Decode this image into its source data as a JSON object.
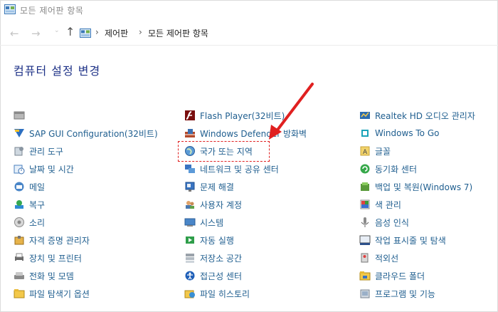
{
  "window": {
    "title": "모든 제어판 항목"
  },
  "address": {
    "nav": {
      "back": "←",
      "forward": "→",
      "recent": "⌄",
      "up": "↑"
    },
    "separator": "›",
    "crumbs": [
      "제어판",
      "모든 제어판 항목"
    ]
  },
  "page": {
    "title": "컴퓨터 설정 변경"
  },
  "columns": [
    [
      {
        "label": "",
        "icon": "generic-window-icon"
      },
      {
        "label": "SAP GUI Configuration(32비트)",
        "icon": "sap-gui-icon"
      },
      {
        "label": "관리 도구",
        "icon": "admin-tools-icon"
      },
      {
        "label": "날짜 및 시간",
        "icon": "date-time-icon"
      },
      {
        "label": "메일",
        "icon": "mail-icon"
      },
      {
        "label": "복구",
        "icon": "recovery-icon"
      },
      {
        "label": "소리",
        "icon": "sound-icon"
      },
      {
        "label": "자격 증명 관리자",
        "icon": "credential-manager-icon"
      },
      {
        "label": "장치 및 프린터",
        "icon": "devices-printers-icon"
      },
      {
        "label": "전화 및 모뎀",
        "icon": "phone-modem-icon"
      },
      {
        "label": "파일 탐색기 옵션",
        "icon": "file-explorer-options-icon"
      }
    ],
    [
      {
        "label": "Flash Player(32비트)",
        "icon": "flash-player-icon"
      },
      {
        "label": "Windows Defender 방화벽",
        "icon": "firewall-icon"
      },
      {
        "label": "국가 또는 지역",
        "icon": "region-icon"
      },
      {
        "label": "네트워크 및 공유 센터",
        "icon": "network-sharing-icon"
      },
      {
        "label": "문제 해결",
        "icon": "troubleshooting-icon"
      },
      {
        "label": "사용자 계정",
        "icon": "user-accounts-icon"
      },
      {
        "label": "시스템",
        "icon": "system-icon"
      },
      {
        "label": "자동 실행",
        "icon": "autoplay-icon"
      },
      {
        "label": "저장소 공간",
        "icon": "storage-spaces-icon"
      },
      {
        "label": "접근성 센터",
        "icon": "ease-of-access-icon"
      },
      {
        "label": "파일 히스토리",
        "icon": "file-history-icon"
      }
    ],
    [
      {
        "label": "Realtek HD 오디오 관리자",
        "icon": "realtek-audio-icon"
      },
      {
        "label": "Windows To Go",
        "icon": "windows-to-go-icon"
      },
      {
        "label": "글꼴",
        "icon": "fonts-icon"
      },
      {
        "label": "동기화 센터",
        "icon": "sync-center-icon"
      },
      {
        "label": "백업 및 복원(Windows 7)",
        "icon": "backup-restore-icon"
      },
      {
        "label": "색 관리",
        "icon": "color-management-icon"
      },
      {
        "label": "음성 인식",
        "icon": "speech-recognition-icon"
      },
      {
        "label": "작업 표시줄 및 탐색",
        "icon": "taskbar-navigation-icon"
      },
      {
        "label": "적외선",
        "icon": "infrared-icon"
      },
      {
        "label": "클라우드 폴더",
        "icon": "work-folders-icon"
      },
      {
        "label": "프로그램 및 기능",
        "icon": "programs-features-icon"
      }
    ]
  ],
  "annotation": {
    "color": "#e02020",
    "target": "국가 또는 지역"
  }
}
